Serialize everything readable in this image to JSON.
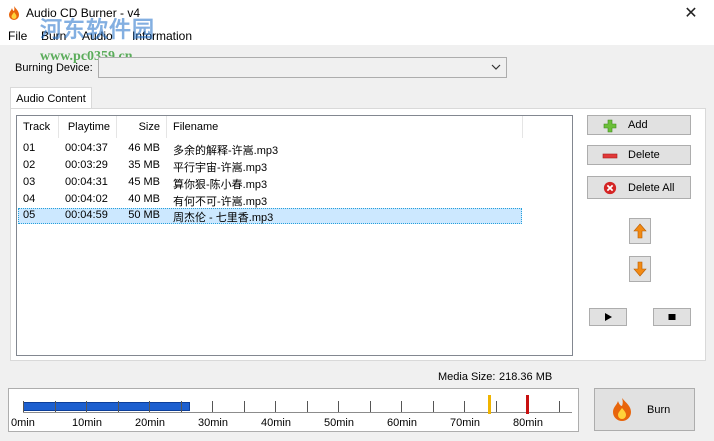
{
  "window": {
    "title": "Audio CD Burner - v4",
    "close_glyph": "✕",
    "app_icon": "flame-icon"
  },
  "watermark": {
    "site_name": "河东软件园",
    "url": "www.pc0359.cn"
  },
  "menu": {
    "items": [
      "File",
      "Burn",
      "Audio",
      "Information"
    ]
  },
  "device": {
    "label": "Burning Device:",
    "value": ""
  },
  "tabs": {
    "active": "Audio Content"
  },
  "list": {
    "columns": [
      "Track",
      "Playtime",
      "Size",
      "Filename"
    ],
    "rows": [
      {
        "track": "01",
        "playtime": "00:04:37",
        "size": "46 MB",
        "filename": "多余的解释-许嵩.mp3",
        "selected": false
      },
      {
        "track": "02",
        "playtime": "00:03:29",
        "size": "35 MB",
        "filename": "平行宇宙-许嵩.mp3",
        "selected": false
      },
      {
        "track": "03",
        "playtime": "00:04:31",
        "size": "45 MB",
        "filename": "算你狠-陈小春.mp3",
        "selected": false
      },
      {
        "track": "04",
        "playtime": "00:04:02",
        "size": "40 MB",
        "filename": "有何不可-许嵩.mp3",
        "selected": false
      },
      {
        "track": "05",
        "playtime": "00:04:59",
        "size": "50 MB",
        "filename": "周杰伦 - 七里香.mp3",
        "selected": true
      }
    ]
  },
  "buttons": {
    "add": "Add",
    "delete": "Delete",
    "delete_all": "Delete All",
    "burn": "Burn"
  },
  "media": {
    "label": "Media Size:",
    "value": "218.36 MB"
  },
  "timeline": {
    "labels": [
      "0min",
      "10min",
      "20min",
      "30min",
      "40min",
      "50min",
      "60min",
      "70min",
      "80min"
    ],
    "max_min": 87,
    "used_min": 26.5,
    "warn_marker_min": 74,
    "limit_marker_min": 80,
    "colors": {
      "fill": "#1c5fcf",
      "warn": "#f0b400",
      "limit": "#c81010"
    }
  }
}
